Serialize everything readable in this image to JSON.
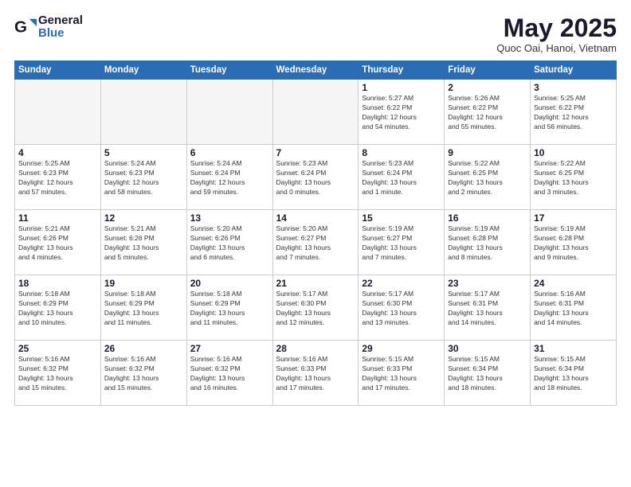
{
  "header": {
    "logo_general": "General",
    "logo_blue": "Blue",
    "title": "May 2025",
    "subtitle": "Quoc Oai, Hanoi, Vietnam"
  },
  "weekdays": [
    "Sunday",
    "Monday",
    "Tuesday",
    "Wednesday",
    "Thursday",
    "Friday",
    "Saturday"
  ],
  "weeks": [
    [
      {
        "day": "",
        "info": ""
      },
      {
        "day": "",
        "info": ""
      },
      {
        "day": "",
        "info": ""
      },
      {
        "day": "",
        "info": ""
      },
      {
        "day": "1",
        "info": "Sunrise: 5:27 AM\nSunset: 6:22 PM\nDaylight: 12 hours\nand 54 minutes."
      },
      {
        "day": "2",
        "info": "Sunrise: 5:26 AM\nSunset: 6:22 PM\nDaylight: 12 hours\nand 55 minutes."
      },
      {
        "day": "3",
        "info": "Sunrise: 5:25 AM\nSunset: 6:22 PM\nDaylight: 12 hours\nand 56 minutes."
      }
    ],
    [
      {
        "day": "4",
        "info": "Sunrise: 5:25 AM\nSunset: 6:23 PM\nDaylight: 12 hours\nand 57 minutes."
      },
      {
        "day": "5",
        "info": "Sunrise: 5:24 AM\nSunset: 6:23 PM\nDaylight: 12 hours\nand 58 minutes."
      },
      {
        "day": "6",
        "info": "Sunrise: 5:24 AM\nSunset: 6:24 PM\nDaylight: 12 hours\nand 59 minutes."
      },
      {
        "day": "7",
        "info": "Sunrise: 5:23 AM\nSunset: 6:24 PM\nDaylight: 13 hours\nand 0 minutes."
      },
      {
        "day": "8",
        "info": "Sunrise: 5:23 AM\nSunset: 6:24 PM\nDaylight: 13 hours\nand 1 minute."
      },
      {
        "day": "9",
        "info": "Sunrise: 5:22 AM\nSunset: 6:25 PM\nDaylight: 13 hours\nand 2 minutes."
      },
      {
        "day": "10",
        "info": "Sunrise: 5:22 AM\nSunset: 6:25 PM\nDaylight: 13 hours\nand 3 minutes."
      }
    ],
    [
      {
        "day": "11",
        "info": "Sunrise: 5:21 AM\nSunset: 6:26 PM\nDaylight: 13 hours\nand 4 minutes."
      },
      {
        "day": "12",
        "info": "Sunrise: 5:21 AM\nSunset: 6:26 PM\nDaylight: 13 hours\nand 5 minutes."
      },
      {
        "day": "13",
        "info": "Sunrise: 5:20 AM\nSunset: 6:26 PM\nDaylight: 13 hours\nand 6 minutes."
      },
      {
        "day": "14",
        "info": "Sunrise: 5:20 AM\nSunset: 6:27 PM\nDaylight: 13 hours\nand 7 minutes."
      },
      {
        "day": "15",
        "info": "Sunrise: 5:19 AM\nSunset: 6:27 PM\nDaylight: 13 hours\nand 7 minutes."
      },
      {
        "day": "16",
        "info": "Sunrise: 5:19 AM\nSunset: 6:28 PM\nDaylight: 13 hours\nand 8 minutes."
      },
      {
        "day": "17",
        "info": "Sunrise: 5:19 AM\nSunset: 6:28 PM\nDaylight: 13 hours\nand 9 minutes."
      }
    ],
    [
      {
        "day": "18",
        "info": "Sunrise: 5:18 AM\nSunset: 6:29 PM\nDaylight: 13 hours\nand 10 minutes."
      },
      {
        "day": "19",
        "info": "Sunrise: 5:18 AM\nSunset: 6:29 PM\nDaylight: 13 hours\nand 11 minutes."
      },
      {
        "day": "20",
        "info": "Sunrise: 5:18 AM\nSunset: 6:29 PM\nDaylight: 13 hours\nand 11 minutes."
      },
      {
        "day": "21",
        "info": "Sunrise: 5:17 AM\nSunset: 6:30 PM\nDaylight: 13 hours\nand 12 minutes."
      },
      {
        "day": "22",
        "info": "Sunrise: 5:17 AM\nSunset: 6:30 PM\nDaylight: 13 hours\nand 13 minutes."
      },
      {
        "day": "23",
        "info": "Sunrise: 5:17 AM\nSunset: 6:31 PM\nDaylight: 13 hours\nand 14 minutes."
      },
      {
        "day": "24",
        "info": "Sunrise: 5:16 AM\nSunset: 6:31 PM\nDaylight: 13 hours\nand 14 minutes."
      }
    ],
    [
      {
        "day": "25",
        "info": "Sunrise: 5:16 AM\nSunset: 6:32 PM\nDaylight: 13 hours\nand 15 minutes."
      },
      {
        "day": "26",
        "info": "Sunrise: 5:16 AM\nSunset: 6:32 PM\nDaylight: 13 hours\nand 15 minutes."
      },
      {
        "day": "27",
        "info": "Sunrise: 5:16 AM\nSunset: 6:32 PM\nDaylight: 13 hours\nand 16 minutes."
      },
      {
        "day": "28",
        "info": "Sunrise: 5:16 AM\nSunset: 6:33 PM\nDaylight: 13 hours\nand 17 minutes."
      },
      {
        "day": "29",
        "info": "Sunrise: 5:15 AM\nSunset: 6:33 PM\nDaylight: 13 hours\nand 17 minutes."
      },
      {
        "day": "30",
        "info": "Sunrise: 5:15 AM\nSunset: 6:34 PM\nDaylight: 13 hours\nand 18 minutes."
      },
      {
        "day": "31",
        "info": "Sunrise: 5:15 AM\nSunset: 6:34 PM\nDaylight: 13 hours\nand 18 minutes."
      }
    ]
  ]
}
